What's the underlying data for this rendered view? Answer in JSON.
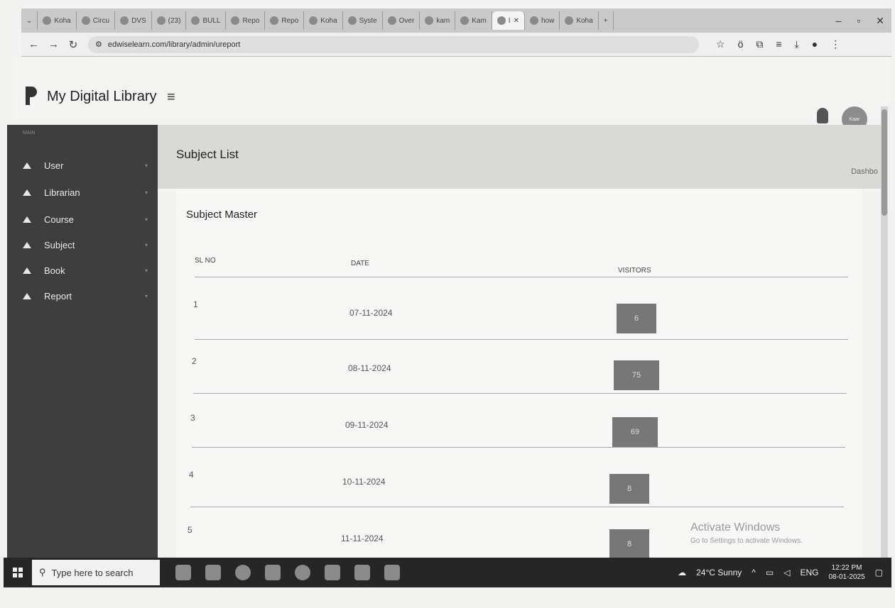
{
  "browser": {
    "tabs": [
      "Koha",
      "Circu",
      "DVS",
      "(23)",
      "BULL",
      "Repo",
      "Repo",
      "Koha",
      "Syste",
      "Over",
      "kam",
      "Kam",
      "I",
      "how",
      "Koha"
    ],
    "active_tab_index": 12,
    "url": "edwiselearn.com/library/admin/ureport"
  },
  "app": {
    "title": "My Digital Library",
    "avatar_label": "Kaar"
  },
  "sidebar": {
    "caption": "MAIN",
    "items": [
      {
        "label": "User"
      },
      {
        "label": "Librarian"
      },
      {
        "label": "Course"
      },
      {
        "label": "Subject"
      },
      {
        "label": "Book"
      },
      {
        "label": "Report"
      }
    ]
  },
  "page": {
    "title": "Subject List",
    "breadcrumb": "Dashbo"
  },
  "card": {
    "title": "Subject Master",
    "columns": [
      "SL NO",
      "DATE",
      "VISITORS"
    ],
    "rows": [
      {
        "sl": "1",
        "date": "07-11-2024",
        "visitors": "6"
      },
      {
        "sl": "2",
        "date": "08-11-2024",
        "visitors": "75"
      },
      {
        "sl": "3",
        "date": "09-11-2024",
        "visitors": "69"
      },
      {
        "sl": "4",
        "date": "10-11-2024",
        "visitors": "8"
      },
      {
        "sl": "5",
        "date": "11-11-2024",
        "visitors": "8"
      }
    ]
  },
  "watermark": {
    "line1": "Activate Windows",
    "line2": "Go to Settings to activate Windows."
  },
  "taskbar": {
    "search_placeholder": "Type here to search",
    "weather": "24°C Sunny",
    "language": "ENG",
    "time": "12:22 PM",
    "date": "08-01-2025"
  }
}
